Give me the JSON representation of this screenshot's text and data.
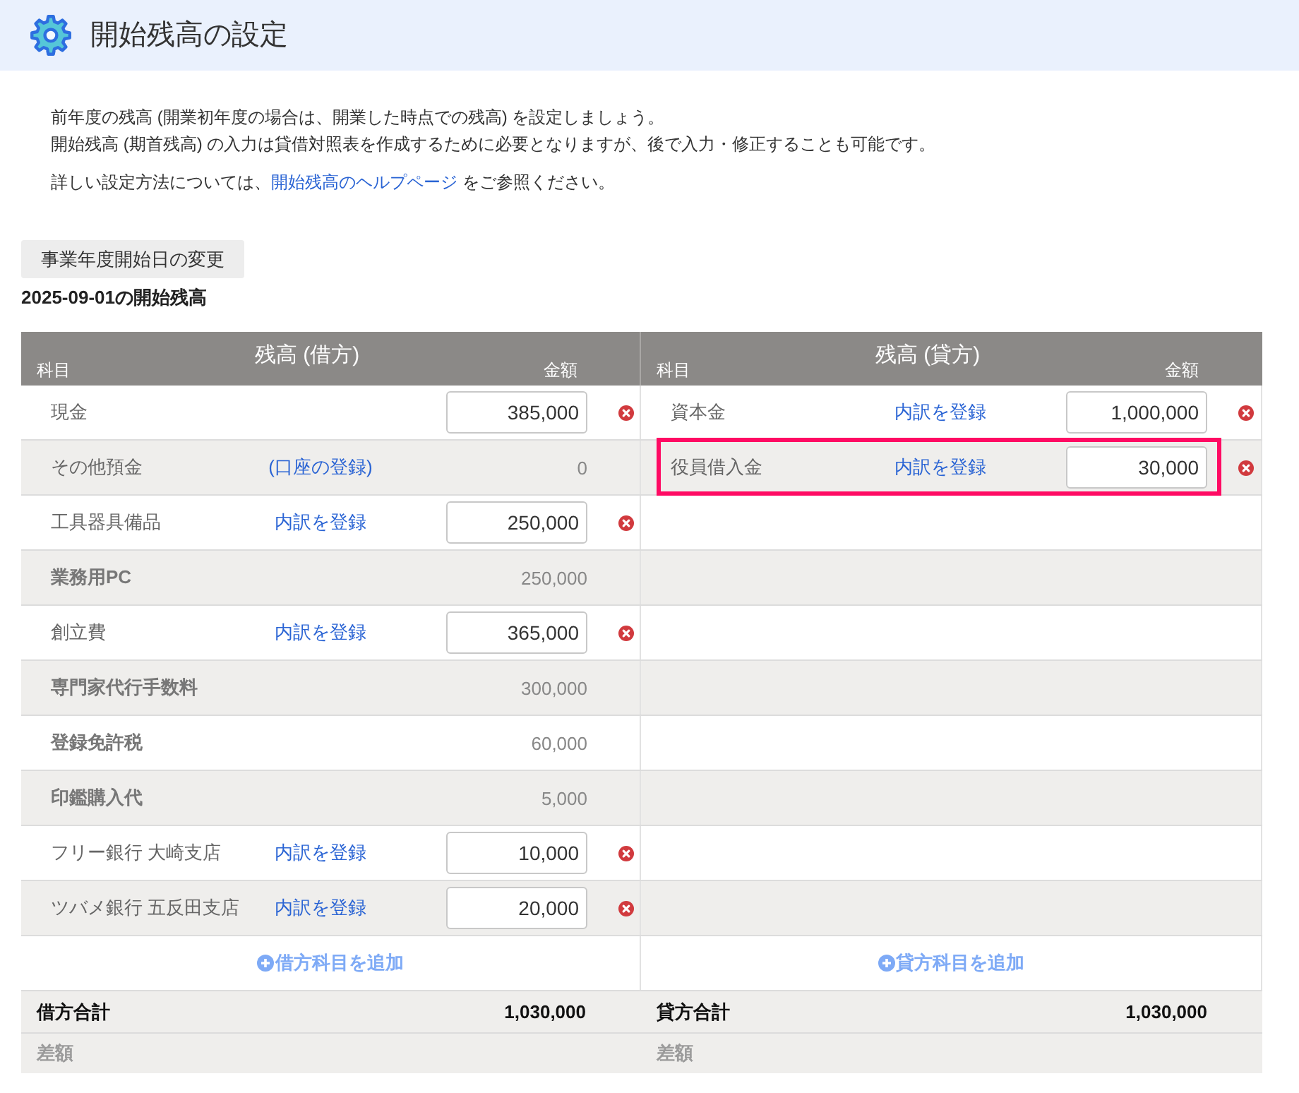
{
  "header": {
    "title": "開始残高の設定"
  },
  "intro": {
    "lines": [
      "前年度の残高 (開業初年度の場合は、開業した時点での残高) を設定しましょう。",
      "開始残高 (期首残高) の入力は貸借対照表を作成するために必要となりますが、後で入力・修正することも可能です。"
    ],
    "help": {
      "before": "詳しい設定方法については、",
      "link": "開始残高のヘルプページ",
      "after": " をご参照ください。"
    }
  },
  "change_start_date_button": "事業年度開始日の変更",
  "balance_title": "2025-09-01の開始残高",
  "sides": [
    {
      "heading": "残高 (借方)",
      "account_column": "科目",
      "amount_column": "金額",
      "rows": [
        {
          "kind": "entry",
          "account": "現金",
          "amount": "385,000",
          "highlighted": false
        },
        {
          "kind": "linked",
          "account": "その他預金",
          "link": "(口座の登録)",
          "amount": "0",
          "highlighted": false
        },
        {
          "kind": "entry",
          "account": "工具器具備品",
          "link": "内訳を登録",
          "amount": "250,000",
          "highlighted": false
        },
        {
          "kind": "breakdown",
          "account": "業務用PC",
          "amount": "250,000",
          "highlighted": false
        },
        {
          "kind": "entry",
          "account": "創立費",
          "link": "内訳を登録",
          "amount": "365,000",
          "highlighted": false
        },
        {
          "kind": "breakdown",
          "account": "専門家代行手数料",
          "amount": "300,000",
          "highlighted": false
        },
        {
          "kind": "breakdown",
          "account": "登録免許税",
          "amount": "60,000",
          "highlighted": false
        },
        {
          "kind": "breakdown",
          "account": "印鑑購入代",
          "amount": "5,000",
          "highlighted": false
        },
        {
          "kind": "entry",
          "account": "フリー銀行 大崎支店",
          "link": "内訳を登録",
          "amount": "10,000",
          "highlighted": false
        },
        {
          "kind": "entry",
          "account": "ツバメ銀行 五反田支店",
          "link": "内訳を登録",
          "amount": "20,000",
          "highlighted": false
        }
      ],
      "add_label": "借方科目を追加",
      "total_label": "借方合計",
      "total_value": "1,030,000",
      "difference_label": "差額"
    },
    {
      "heading": "残高 (貸方)",
      "account_column": "科目",
      "amount_column": "金額",
      "rows": [
        {
          "kind": "entry",
          "account": "資本金",
          "link": "内訳を登録",
          "amount": "1,000,000",
          "highlighted": false
        },
        {
          "kind": "entry",
          "account": "役員借入金",
          "link": "内訳を登録",
          "amount": "30,000",
          "highlighted": true
        }
      ],
      "add_label": "貸方科目を追加",
      "total_label": "貸方合計",
      "total_value": "1,030,000",
      "difference_label": "差額"
    }
  ]
}
